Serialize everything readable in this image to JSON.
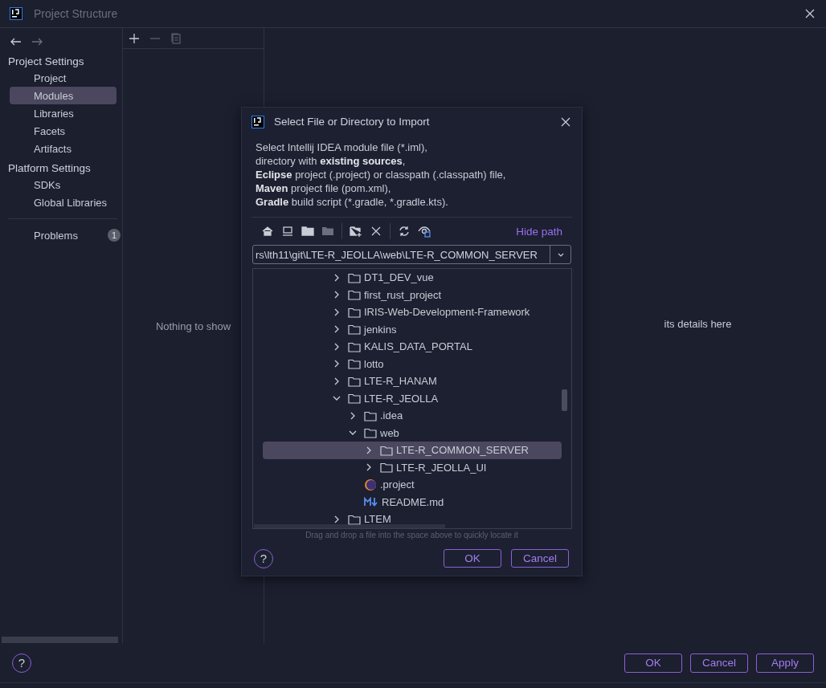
{
  "window": {
    "title": "Project Structure"
  },
  "sidebar": {
    "groups": [
      {
        "title": "Project Settings",
        "items": [
          {
            "label": "Project",
            "selected": false
          },
          {
            "label": "Modules",
            "selected": true
          },
          {
            "label": "Libraries",
            "selected": false
          },
          {
            "label": "Facets",
            "selected": false
          },
          {
            "label": "Artifacts",
            "selected": false
          }
        ]
      },
      {
        "title": "Platform Settings",
        "items": [
          {
            "label": "SDKs",
            "selected": false
          },
          {
            "label": "Global Libraries",
            "selected": false
          }
        ]
      }
    ],
    "problems": {
      "label": "Problems",
      "count": "1"
    }
  },
  "middle_panel": {
    "empty_text": "Nothing to show"
  },
  "details_panel": {
    "hint": "its details here"
  },
  "dialog": {
    "title": "Select File or Directory to Import",
    "description": [
      "Select Intellij IDEA module file (*.iml),",
      "directory with **existing sources**,",
      "**Eclipse** project (.project) or classpath (.classpath) file,",
      "**Maven** project file (pom.xml),",
      "**Gradle** build script (*.gradle, *.gradle.kts)."
    ],
    "hide_path": "Hide path",
    "path": "rs\\lth11\\git\\LTE-R_JEOLLA\\web\\LTE-R_COMMON_SERVER",
    "tree": [
      {
        "kind": "folder",
        "label": "DT1_DEV_vue",
        "expanded": false,
        "selected": false
      },
      {
        "kind": "folder",
        "label": "first_rust_project",
        "expanded": false,
        "selected": false
      },
      {
        "kind": "folder",
        "label": "IRIS-Web-Development-Framework",
        "expanded": false,
        "selected": false
      },
      {
        "kind": "folder",
        "label": "jenkins",
        "expanded": false,
        "selected": false
      },
      {
        "kind": "folder",
        "label": "KALIS_DATA_PORTAL",
        "expanded": false,
        "selected": false
      },
      {
        "kind": "folder",
        "label": "lotto",
        "expanded": false,
        "selected": false
      },
      {
        "kind": "folder",
        "label": "LTE-R_HANAM",
        "expanded": false,
        "selected": false
      },
      {
        "kind": "folder",
        "label": "LTE-R_JEOLLA",
        "expanded": true,
        "selected": false,
        "children": [
          {
            "kind": "folder",
            "label": ".idea",
            "expanded": false,
            "selected": false
          },
          {
            "kind": "folder",
            "label": "web",
            "expanded": true,
            "selected": false,
            "children": [
              {
                "kind": "folder",
                "label": "LTE-R_COMMON_SERVER",
                "expanded": false,
                "selected": true
              },
              {
                "kind": "folder",
                "label": "LTE-R_JEOLLA_UI",
                "expanded": false,
                "selected": false
              }
            ]
          },
          {
            "kind": "eclipse",
            "label": ".project",
            "selected": false
          },
          {
            "kind": "markdown",
            "label": "README.md",
            "selected": false
          }
        ]
      },
      {
        "kind": "folder",
        "label": "LTEM",
        "expanded": false,
        "selected": false
      }
    ],
    "drop_hint": "Drag and drop a file into the space above to quickly locate it",
    "help": "?",
    "buttons": [
      "OK",
      "Cancel"
    ]
  },
  "footer_help": "?",
  "footer_buttons": [
    "OK",
    "Cancel",
    "Apply"
  ]
}
